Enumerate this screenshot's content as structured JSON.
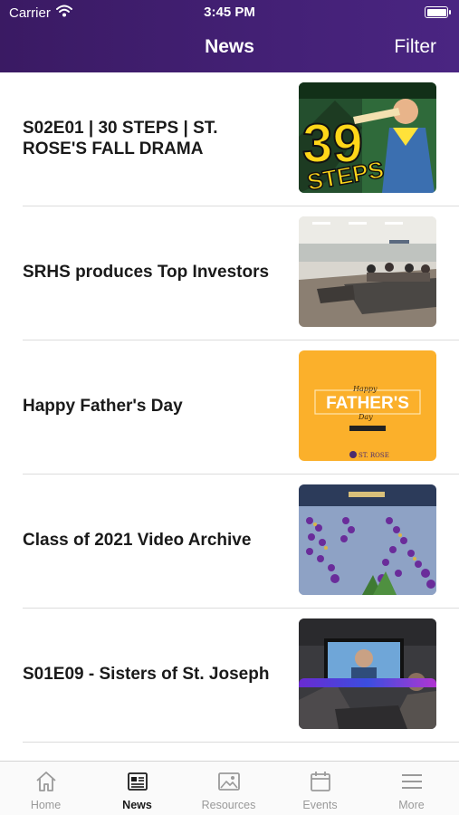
{
  "status_bar": {
    "carrier": "Carrier",
    "time": "3:45 PM",
    "battery_level": 1.0
  },
  "nav": {
    "title": "News",
    "filter_label": "Filter"
  },
  "news_items": [
    {
      "title": "S02E01 | 30 STEPS | ST. ROSE'S FALL DRAMA",
      "thumb_text_1": "39",
      "thumb_text_2": "STEPS"
    },
    {
      "title": "SRHS produces Top Investors"
    },
    {
      "title": "Happy Father's Day",
      "thumb_text_1": "FATHER'S",
      "thumb_text_2": "ST. ROSE"
    },
    {
      "title": "Class of 2021 Video Archive"
    },
    {
      "title": "S01E09 - Sisters of St. Joseph"
    }
  ],
  "tabs": [
    {
      "label": "Home",
      "icon": "home-icon"
    },
    {
      "label": "News",
      "icon": "news-icon"
    },
    {
      "label": "Resources",
      "icon": "image-icon"
    },
    {
      "label": "Events",
      "icon": "calendar-icon"
    },
    {
      "label": "More",
      "icon": "menu-icon"
    }
  ],
  "colors": {
    "header": "#3a1a63",
    "active_tab": "#1a1a1a",
    "inactive_tab": "#9a9a9a"
  }
}
